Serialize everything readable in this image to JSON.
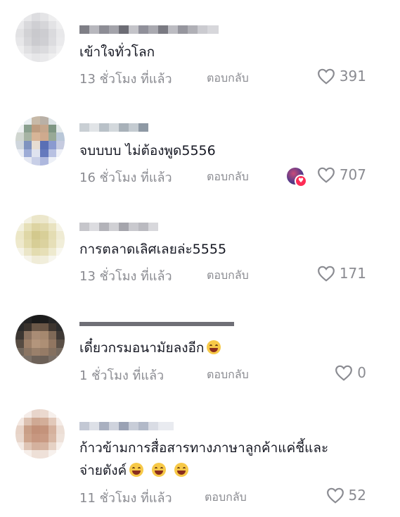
{
  "ui": {
    "reply_label": "ตอบกลับ",
    "heart_icon": "heart-outline-icon"
  },
  "comments": [
    {
      "text": "เข้าใจทั่วโลก",
      "time": "13 ชั่วโมง ที่แล้ว",
      "likes": "391"
    },
    {
      "text": "จบบบบ ไม่ต้องพูด5556",
      "time": "16 ชั่วโมง ที่แล้ว",
      "likes": "707",
      "creator_liked": true
    },
    {
      "text": "การตลาดเลิศเลยล่ะ5555",
      "time": "13 ชั่วโมง ที่แล้ว",
      "likes": "171"
    },
    {
      "text": "เดี๋ยวกรมอนามัยลงอีก",
      "time": "1 ชั่วโมง ที่แล้ว",
      "likes": "0",
      "emoji": "rolling-laughing-emoji"
    },
    {
      "text_line1": "ก้าวข้ามการสื่อสารทางภาษาลูกค้าแค่ชี้และ",
      "text_line2": "จ่ายตังค์",
      "time": "11 ชั่วโมง ที่แล้ว",
      "likes": "52",
      "emoji": "grinning-squinting-emoji"
    }
  ]
}
